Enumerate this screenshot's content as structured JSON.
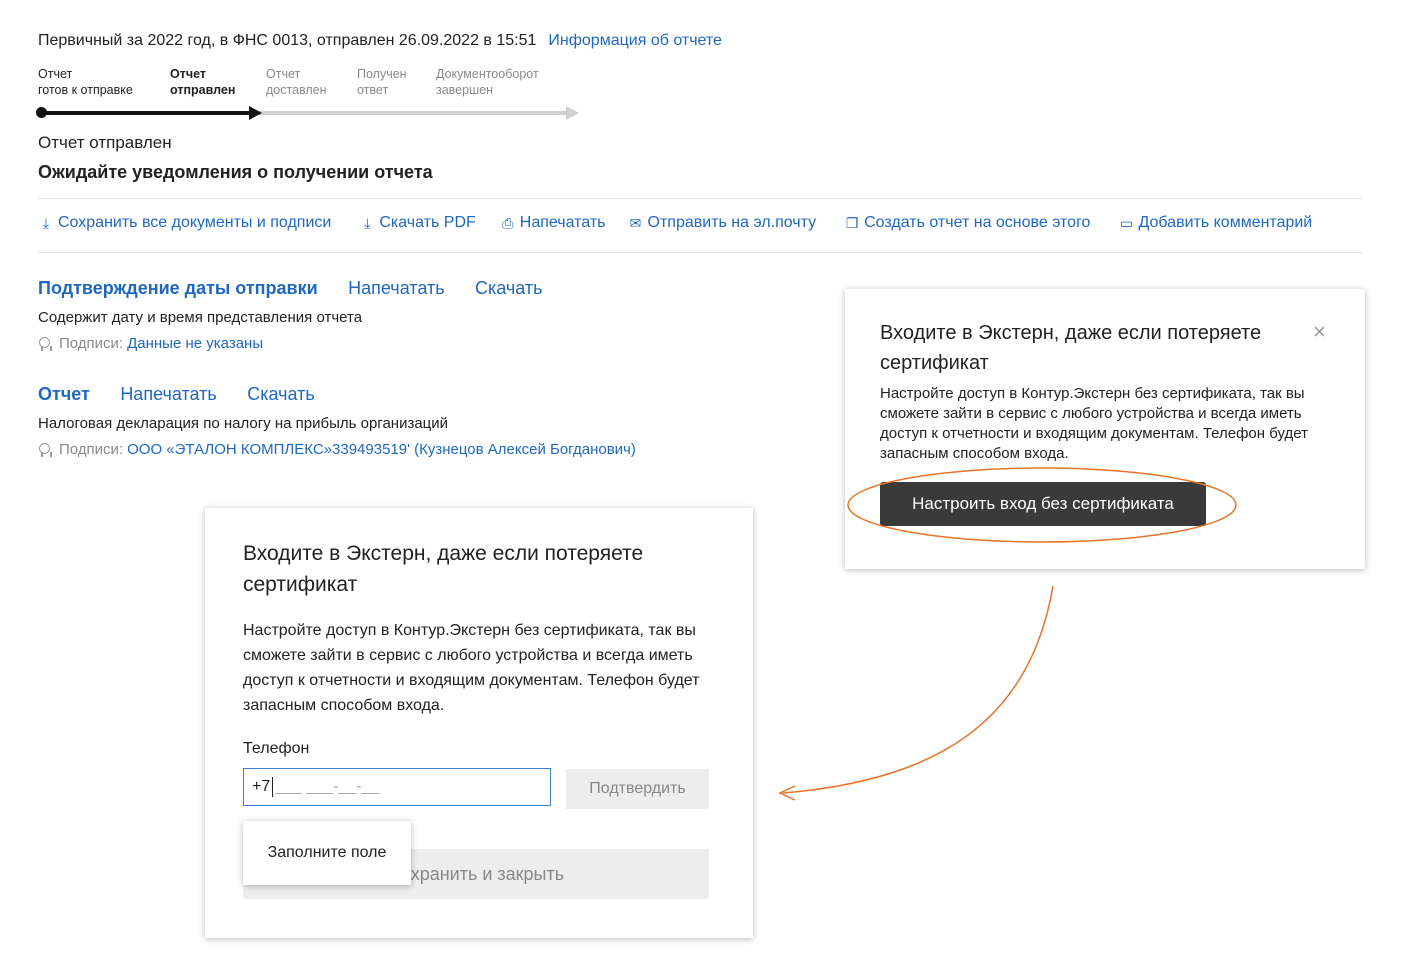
{
  "header": {
    "summary": "Первичный за 2022 год, в ФНС 0013, отправлен 26.09.2022 в 15:51",
    "info_link": "Информация об отчете"
  },
  "progress": {
    "steps": [
      {
        "label": "Отчет\nготов к отправке",
        "state": "done"
      },
      {
        "label": "Отчет\nотправлен",
        "state": "current"
      },
      {
        "label": "Отчет\nдоставлен",
        "state": "pending"
      },
      {
        "label": "Получен\nответ",
        "state": "pending"
      },
      {
        "label": "Документооборот\nзавершен",
        "state": "pending"
      }
    ]
  },
  "status": {
    "state_text": "Отчет отправлен",
    "message": "Ожидайте уведомления о получении отчета"
  },
  "toolbar": {
    "save_all": "Сохранить все документы и подписи",
    "download_pdf": "Скачать PDF",
    "print": "Напечатать",
    "send_email": "Отправить на эл.почту",
    "create_based": "Создать отчет на основе этого",
    "add_comment": "Добавить комментарий"
  },
  "documents": [
    {
      "title": "Подтверждение даты отправки",
      "print": "Напечатать",
      "download": "Скачать",
      "description": "Содержит дату и время представления отчета",
      "signatures_label": "Подписи:",
      "signatures_value": "Данные не указаны"
    },
    {
      "title": "Отчет",
      "print": "Напечатать",
      "download": "Скачать",
      "description": "Налоговая декларация по налогу на прибыль организаций",
      "signatures_label": "Подписи:",
      "signatures_value": "ООО «ЭТАЛОН КОМПЛЕКС»339493519' (Кузнецов Алексей Богданович)"
    }
  ],
  "popup_small": {
    "title": "Входите в Экстерн, даже если потеряете сертификат",
    "body": "Настройте доступ в Контур.Экстерн без сертификата, так вы сможете зайти в сервис с любого устройства и всегда иметь доступ к отчетности и входящим документам. Телефон будет запасным способом входа.",
    "button": "Настроить вход без сертификата",
    "close": "×"
  },
  "popup_large": {
    "title": "Входите в Экстерн, даже если потеряете сертификат",
    "body": "Настройте доступ в Контур.Экстерн без сертификата, так вы сможете зайти в сервис с любого устройства и всегда иметь доступ к отчетности и входящим документам. Телефон будет запасным способом входа.",
    "phone_label": "Телефон",
    "phone_prefix": "+7",
    "phone_mask": "___ ___-__-__",
    "confirm_button": "Подтвердить",
    "save_button": "Сохранить и закрыть",
    "tooltip": "Заполните поле"
  },
  "colors": {
    "link": "#1f68c0",
    "annotation": "#e8742a",
    "dark_button": "#3a3a3a"
  }
}
